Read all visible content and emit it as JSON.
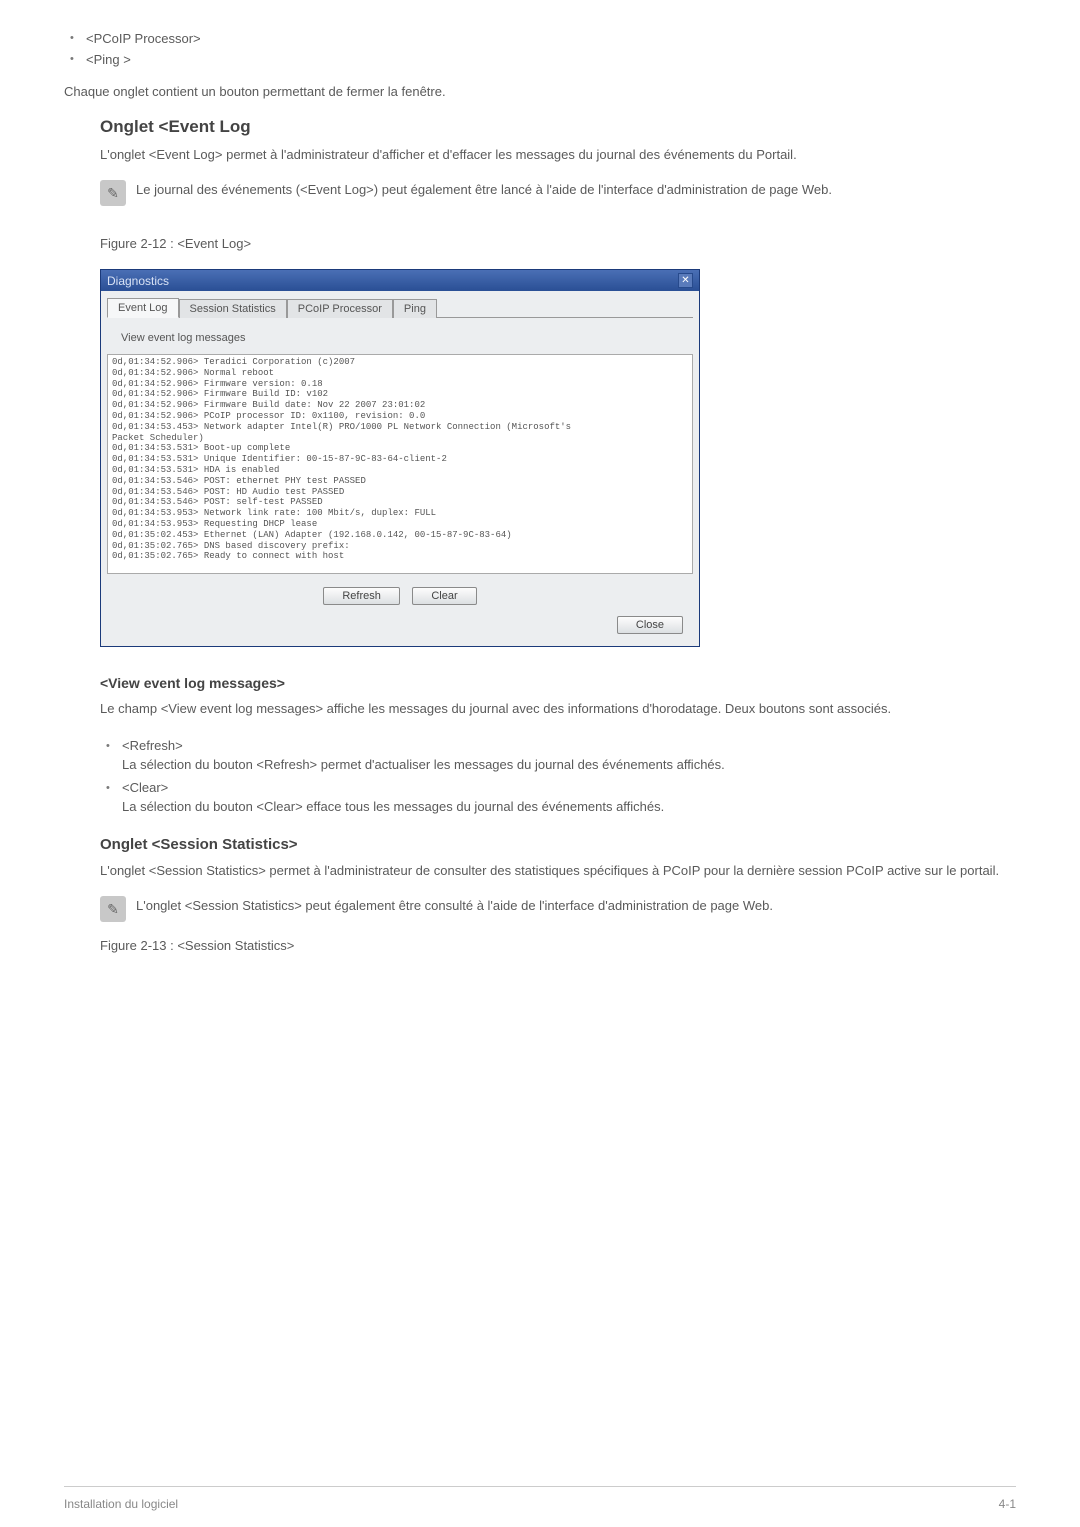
{
  "top_items": [
    "<PCoIP Processor>",
    "<Ping >"
  ],
  "intro_para": "Chaque onglet contient un bouton permettant de fermer la fenêtre.",
  "section_event_log": {
    "title": "Onglet <Event Log",
    "desc": "L'onglet <Event Log> permet à l'administrateur d'afficher et d'effacer les messages du journal des événements du Portail.",
    "note": "Le journal des événements (<Event Log>) peut également être lancé à l'aide de l'interface d'administration de page Web.",
    "figure_caption": "Figure 2-12 : <Event Log>"
  },
  "diag_window": {
    "title": "Diagnostics",
    "tabs": [
      "Event Log",
      "Session Statistics",
      "PCoIP Processor",
      "Ping"
    ],
    "view_label": "View event log messages",
    "log_text": "0d,01:34:52.906> Teradici Corporation (c)2007\n0d,01:34:52.906> Normal reboot\n0d,01:34:52.906> Firmware version: 0.18\n0d,01:34:52.906> Firmware Build ID: v102\n0d,01:34:52.906> Firmware Build date: Nov 22 2007 23:01:02\n0d,01:34:52.906> PCoIP processor ID: 0x1100, revision: 0.0\n0d,01:34:53.453> Network adapter Intel(R) PRO/1000 PL Network Connection (Microsoft's\nPacket Scheduler)\n0d,01:34:53.531> Boot-up complete\n0d,01:34:53.531> Unique Identifier: 00-15-87-9C-83-64-client-2\n0d,01:34:53.531> HDA is enabled\n0d,01:34:53.546> POST: ethernet PHY test PASSED\n0d,01:34:53.546> POST: HD Audio test PASSED\n0d,01:34:53.546> POST: self-test PASSED\n0d,01:34:53.953> Network link rate: 100 Mbit/s, duplex: FULL\n0d,01:34:53.953> Requesting DHCP lease\n0d,01:35:02.453> Ethernet (LAN) Adapter (192.168.0.142, 00-15-87-9C-83-64)\n0d,01:35:02.765> DNS based discovery prefix:\n0d,01:35:02.765> Ready to connect with host",
    "refresh_label": "Refresh",
    "clear_label": "Clear",
    "close_label": "Close"
  },
  "view_messages": {
    "title": "<View event log messages>",
    "desc": "Le champ <View event log messages> affiche les messages du journal avec des informations d'horodatage. Deux boutons sont associés.",
    "items": [
      {
        "label": "<Refresh>",
        "sub": "La sélection du bouton <Refresh> permet d'actualiser les messages du journal des événements affichés."
      },
      {
        "label": "<Clear>",
        "sub": "La sélection du bouton <Clear> efface tous les messages du journal des événements affichés."
      }
    ]
  },
  "session_stats": {
    "title": "Onglet <Session Statistics>",
    "desc": "L'onglet <Session Statistics> permet à l'administrateur de consulter des statistiques spécifiques à PCoIP pour la dernière session PCoIP active sur le portail.",
    "note": "L'onglet <Session Statistics> peut également être consulté à l'aide de l'interface d'administration de page Web.",
    "figure_caption": "Figure 2-13 : <Session Statistics>"
  },
  "footer": {
    "left": "Installation du logiciel",
    "right": "4-1"
  }
}
